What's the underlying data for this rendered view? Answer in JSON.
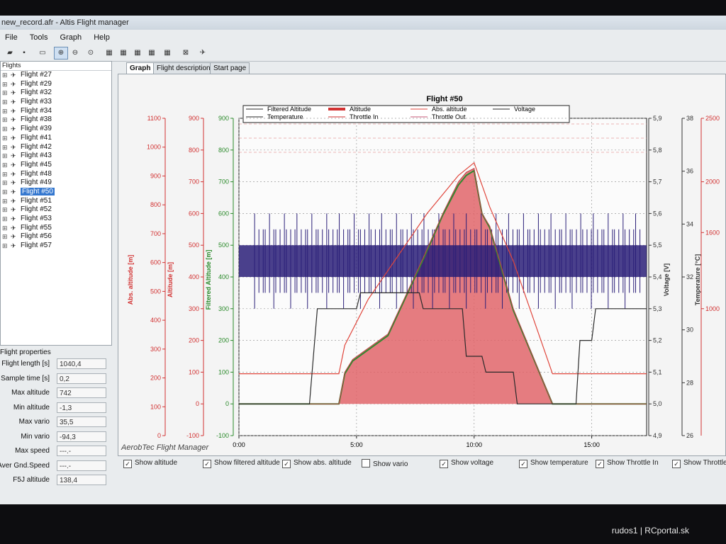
{
  "window": {
    "title": "new_record.afr - Altis Flight manager"
  },
  "menu": [
    "File",
    "Tools",
    "Graph",
    "Help"
  ],
  "toolbar_icons": [
    "open-icon",
    "save-icon",
    "print-icon",
    "zoom-in-icon",
    "zoom-out-icon",
    "zoom-fit-icon",
    "chart-1-icon",
    "chart-2-icon",
    "chart-3-icon",
    "chart-4-icon",
    "chart-5-icon",
    "close-chart-icon",
    "plane-icon"
  ],
  "flights_panel": {
    "title": "Flights",
    "items": [
      "Flight #27",
      "Flight #29",
      "Flight #32",
      "Flight #33",
      "Flight #34",
      "Flight #38",
      "Flight #39",
      "Flight #41",
      "Flight #42",
      "Flight #43",
      "Flight #45",
      "Flight #48",
      "Flight #49",
      "Flight #50",
      "Flight #51",
      "Flight #52",
      "Flight #53",
      "Flight #55",
      "Flight #56",
      "Flight #57"
    ],
    "selected": "Flight #50"
  },
  "properties": {
    "title": "Flight properties",
    "rows": [
      {
        "label": "Flight length [s]",
        "value": "1040,4"
      },
      {
        "label": "Sample time [s]",
        "value": "0,2"
      },
      {
        "label": "Max altitude",
        "value": "742"
      },
      {
        "label": "Min altitude",
        "value": "-1,3"
      },
      {
        "label": "Max vario",
        "value": "35,5"
      },
      {
        "label": "Min vario",
        "value": "-94,3"
      },
      {
        "label": "Max speed",
        "value": "---.-"
      },
      {
        "label": "Aver Gnd.Speed",
        "value": "---.-"
      },
      {
        "label": "F5J altitude",
        "value": "138,4"
      }
    ]
  },
  "tabs": [
    "Graph",
    "Flight description",
    "Start page"
  ],
  "active_tab": "Graph",
  "branding": "AerobTec Flight Manager",
  "checkboxes": [
    {
      "label": "Show altitude",
      "checked": true
    },
    {
      "label": "Show filtered altitude",
      "checked": true
    },
    {
      "label": "Show abs. altitude",
      "checked": true
    },
    {
      "label": "Show vario",
      "checked": false
    },
    {
      "label": "Show voltage",
      "checked": true
    },
    {
      "label": "Show temperature",
      "checked": true
    },
    {
      "label": "Show Throttle In",
      "checked": true
    },
    {
      "label": "Show Throttle",
      "checked": true
    }
  ],
  "watermark": "rudos1 | RCportal.sk",
  "colors": {
    "altitude_fill": "#e0656a",
    "filtered": "#2f8a2f",
    "abs_altitude": "#e0463c",
    "voltage": "#2a2a2a",
    "throttle_in": "#2a1e78",
    "axis_red": "#d23232",
    "axis_green": "#2a8a2a"
  },
  "chart_data": {
    "type": "line",
    "title": "Flight #50",
    "xlabel": "Time [min:s]",
    "x_ticks": [
      "0:00",
      "5:00",
      "10:00",
      "15:00"
    ],
    "x_range_s": [
      0,
      1040
    ],
    "legend": [
      "Filtered Altitude",
      "Altitude",
      "Abs. altitude",
      "Voltage",
      "Temperature",
      "Throttle In",
      "Throttle Out"
    ],
    "legend_position": "top",
    "grid": true,
    "axes": [
      {
        "label": "Abs. altitude [m]",
        "ticks": [
          0,
          100,
          200,
          300,
          400,
          500,
          600,
          700,
          800,
          900,
          1000,
          1100
        ],
        "range": [
          0,
          1100
        ]
      },
      {
        "label": "Altitude [m]",
        "ticks": [
          -100,
          0,
          100,
          200,
          300,
          400,
          500,
          600,
          700,
          800,
          900
        ],
        "range": [
          -100,
          900
        ]
      },
      {
        "label": "Filtered Altitude [m]",
        "ticks": [
          -100,
          0,
          100,
          200,
          300,
          400,
          500,
          600,
          700,
          800,
          900
        ],
        "range": [
          -100,
          900
        ]
      },
      {
        "label": "Voltage [V]",
        "ticks": [
          4.9,
          5.0,
          5.1,
          5.2,
          5.3,
          5.4,
          5.5,
          5.6,
          5.7,
          5.8,
          5.9
        ],
        "tick_labels": [
          "4,9",
          "5,0",
          "5,1",
          "5,2",
          "5,3",
          "5,4",
          "5,5",
          "5,6",
          "5,7",
          "5,8",
          "5,9"
        ],
        "range": [
          4.9,
          5.9
        ]
      },
      {
        "label": "Temperature [°C]",
        "ticks": [
          26,
          28,
          30,
          32,
          34,
          36,
          38
        ],
        "range": [
          26,
          38
        ]
      },
      {
        "label": "",
        "ticks": [
          1000,
          1600,
          2000,
          2500
        ],
        "range": [
          0,
          2500
        ]
      }
    ],
    "series": [
      {
        "name": "Altitude",
        "x_s": [
          0,
          255,
          270,
          290,
          380,
          470,
          520,
          560,
          580,
          600,
          620,
          640,
          700,
          800,
          820,
          1040
        ],
        "y": [
          0,
          0,
          100,
          140,
          220,
          460,
          600,
          700,
          730,
          742,
          600,
          560,
          300,
          0,
          0,
          0
        ]
      },
      {
        "name": "Filtered Altitude",
        "x_s": [
          0,
          255,
          270,
          290,
          380,
          470,
          520,
          560,
          580,
          600,
          620,
          640,
          700,
          800,
          820,
          1040
        ],
        "y": [
          0,
          0,
          95,
          135,
          215,
          455,
          595,
          690,
          720,
          735,
          600,
          555,
          295,
          0,
          0,
          0
        ]
      },
      {
        "name": "Abs. altitude",
        "x_s": [
          0,
          255,
          270,
          330,
          480,
          560,
          600,
          640,
          700,
          800,
          1040
        ],
        "y": [
          95,
          95,
          185,
          330,
          600,
          720,
          760,
          620,
          450,
          95,
          95
        ]
      },
      {
        "name": "Voltage",
        "x_s": [
          0,
          180,
          200,
          300,
          310,
          460,
          470,
          570,
          580,
          620,
          630,
          700,
          710,
          860,
          870,
          900,
          910,
          1040
        ],
        "y": [
          5.0,
          5.0,
          5.3,
          5.3,
          5.35,
          5.35,
          5.3,
          5.3,
          5.15,
          5.15,
          5.1,
          5.1,
          5.0,
          5.0,
          5.2,
          5.2,
          5.3,
          5.3
        ]
      },
      {
        "name": "Throttle In",
        "x_s": [
          0,
          1040
        ],
        "y": [
          400,
          400
        ]
      }
    ]
  }
}
